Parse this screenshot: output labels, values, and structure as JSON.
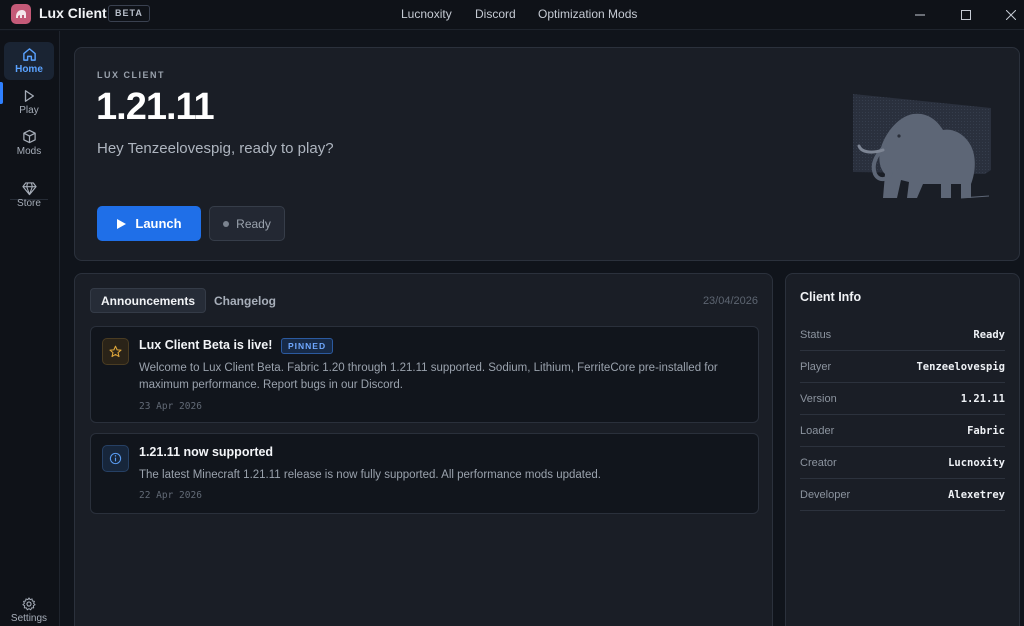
{
  "titlebar": {
    "app_title": "Lux Client",
    "badge": "BETA",
    "nav": [
      "Lucnoxity",
      "Discord",
      "Optimization Mods"
    ]
  },
  "sidebar": {
    "items": [
      {
        "label": "Home",
        "icon": "home-icon",
        "active": true
      },
      {
        "label": "Play",
        "icon": "play-icon",
        "active": false
      },
      {
        "label": "Mods",
        "icon": "cube-icon",
        "active": false
      },
      {
        "label": "Store",
        "icon": "gem-icon",
        "active": false
      }
    ],
    "settings_label": "Settings"
  },
  "hero": {
    "label": "LUX CLIENT",
    "version": "1.21.11",
    "greeting": "Hey Tenzeelovespig, ready to play?",
    "launch_label": "Launch",
    "status_label": "Ready"
  },
  "news": {
    "tabs": [
      "Announcements",
      "Changelog"
    ],
    "date": "23/04/2026",
    "cards": [
      {
        "icon": "star-icon",
        "title": "Lux Client Beta is live!",
        "badge": "PINNED",
        "body": "Welcome to Lux Client Beta. Fabric 1.20 through 1.21.11 supported. Sodium, Lithium, FerriteCore pre-installed for maximum performance. Report bugs in our Discord.",
        "date": "23 Apr 2026"
      },
      {
        "icon": "info-icon",
        "title": "1.21.11 now supported",
        "body": "The latest Minecraft 1.21.11 release is now fully supported. All performance mods updated.",
        "date": "22 Apr 2026"
      }
    ]
  },
  "client_info": {
    "title": "Client Info",
    "rows": [
      {
        "key": "Status",
        "value": "Ready"
      },
      {
        "key": "Player",
        "value": "Tenzeelovespig"
      },
      {
        "key": "Version",
        "value": "1.21.11"
      },
      {
        "key": "Loader",
        "value": "Fabric"
      },
      {
        "key": "Creator",
        "value": "Lucnoxity"
      },
      {
        "key": "Developer",
        "value": "Alexetrey"
      }
    ]
  },
  "colors": {
    "accent": "#1f6fe8",
    "background": "#10141b",
    "panel": "#1a1e26",
    "pinned_text": "#6fa8ff",
    "star": "#e2a93b"
  }
}
